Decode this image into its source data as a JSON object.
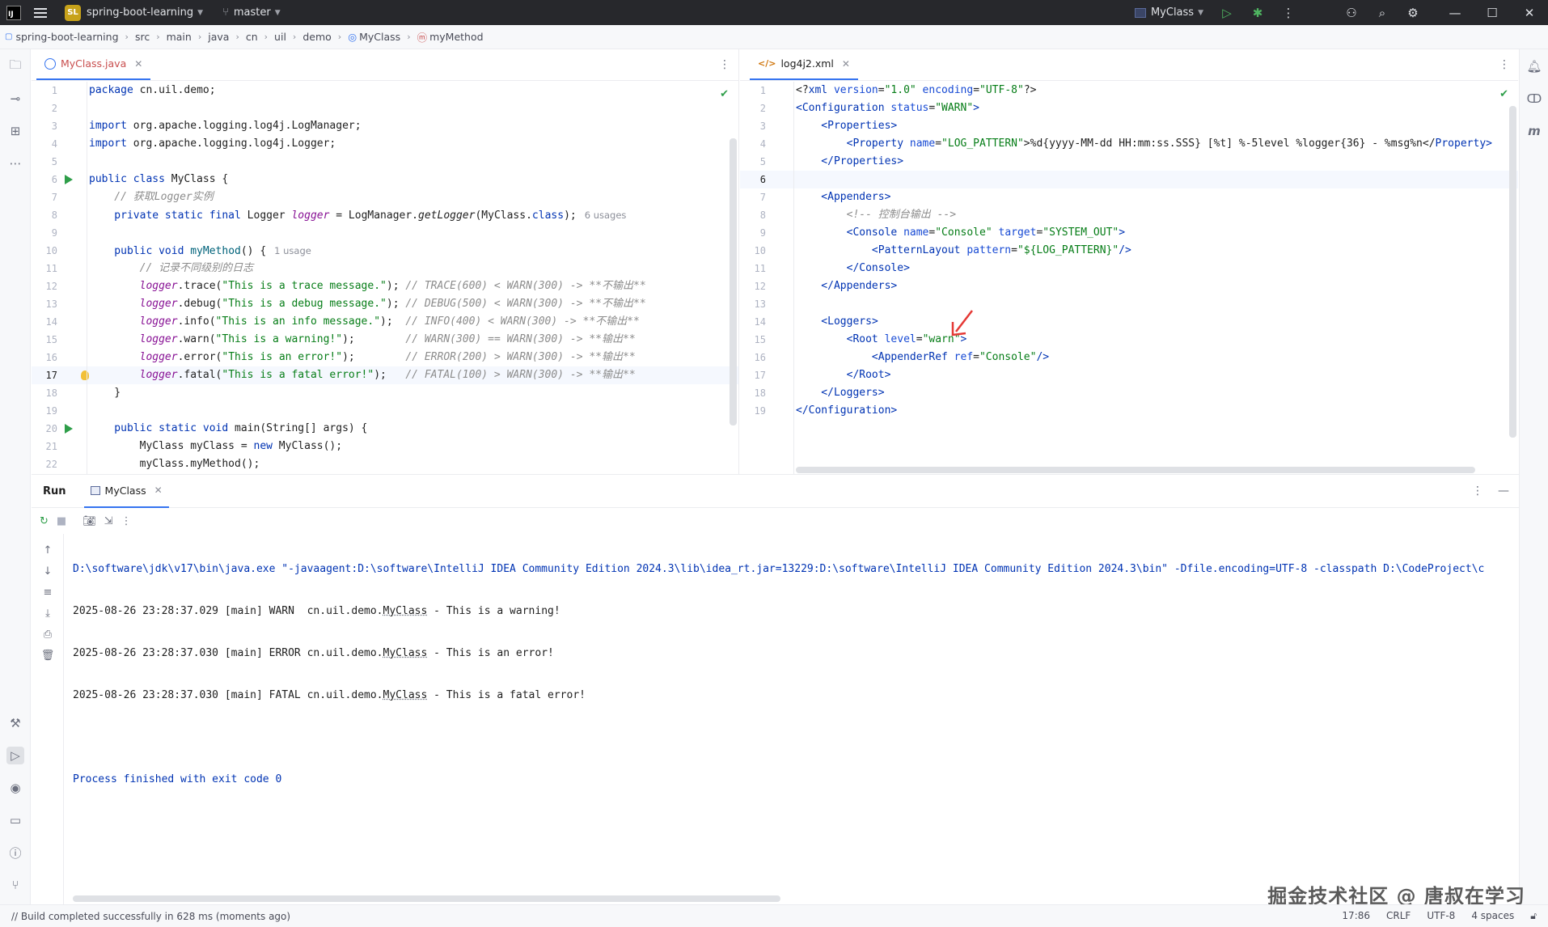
{
  "titlebar": {
    "app_logo": "IJ",
    "project_badge": "SL",
    "project_name": "spring-boot-learning",
    "branch": "master",
    "run_config": "MyClass"
  },
  "breadcrumb": [
    "spring-boot-learning",
    "src",
    "main",
    "java",
    "cn",
    "uil",
    "demo",
    "MyClass",
    "myMethod"
  ],
  "left_editor": {
    "tab": "MyClass.java",
    "lines": [
      {
        "n": "1"
      },
      {
        "n": "2"
      },
      {
        "n": "3"
      },
      {
        "n": "4"
      },
      {
        "n": "5"
      },
      {
        "n": "6"
      },
      {
        "n": "7"
      },
      {
        "n": "8"
      },
      {
        "n": "9"
      },
      {
        "n": "10"
      },
      {
        "n": "11"
      },
      {
        "n": "12"
      },
      {
        "n": "13"
      },
      {
        "n": "14"
      },
      {
        "n": "15"
      },
      {
        "n": "16"
      },
      {
        "n": "17"
      },
      {
        "n": "18"
      },
      {
        "n": "19"
      },
      {
        "n": "20"
      },
      {
        "n": "21"
      },
      {
        "n": "22"
      }
    ],
    "code": {
      "l1_pkg": "package",
      "l1_name": " cn.uil.demo;",
      "l3_imp": "import",
      "l3_name": " org.apache.logging.log4j.LogManager;",
      "l4_imp": "import",
      "l4_name": " org.apache.logging.log4j.Logger;",
      "l6_kw": "public class",
      "l6_name": " MyClass {",
      "l7_cm": "    // 获取Logger实例",
      "l8_kw": "    private static final",
      "l8_type": " Logger ",
      "l8_fld": "logger",
      "l8_eq": " = LogManager.",
      "l8_mth": "getLogger",
      "l8_arg": "(MyClass.",
      "l8_cls": "class",
      "l8_end": ");",
      "l8_hint": "6 usages",
      "l10_kw": "    public void",
      "l10_name": " myMethod",
      "l10_end": "() {",
      "l10_hint": "1 usage",
      "l11_cm": "        // 记录不同级别的日志",
      "l12_fld": "        logger",
      "l12_call": ".trace(",
      "l12_str": "\"This is a trace message.\"",
      "l12_end": "); ",
      "l12_cm": "// TRACE(600) < WARN(300) -> **不输出**",
      "l13_fld": "        logger",
      "l13_call": ".debug(",
      "l13_str": "\"This is a debug message.\"",
      "l13_end": "); ",
      "l13_cm": "// DEBUG(500) < WARN(300) -> **不输出**",
      "l14_fld": "        logger",
      "l14_call": ".info(",
      "l14_str": "\"This is an info message.\"",
      "l14_end": ");  ",
      "l14_cm": "// INFO(400) < WARN(300) -> **不输出**",
      "l15_fld": "        logger",
      "l15_call": ".warn(",
      "l15_str": "\"This is a warning!\"",
      "l15_end": ");        ",
      "l15_cm": "// WARN(300) == WARN(300) -> **输出**",
      "l16_fld": "        logger",
      "l16_call": ".error(",
      "l16_str": "\"This is an error!\"",
      "l16_end": ");        ",
      "l16_cm": "// ERROR(200) > WARN(300) -> **输出**",
      "l17_fld": "        logger",
      "l17_call": ".fatal(",
      "l17_str": "\"This is a fatal error!\"",
      "l17_end": ");   ",
      "l17_cm": "// FATAL(100) > WARN(300) -> **输出**",
      "l18": "    }",
      "l20_kw": "    public static void",
      "l20_name": " main(String[] args) {",
      "l21_a": "        MyClass myClass = ",
      "l21_kw": "new",
      "l21_b": " MyClass();",
      "l22": "        myClass.myMethod();"
    }
  },
  "right_editor": {
    "tab": "log4j2.xml",
    "lines": [
      {
        "n": "1"
      },
      {
        "n": "2"
      },
      {
        "n": "3"
      },
      {
        "n": "4"
      },
      {
        "n": "5"
      },
      {
        "n": "6"
      },
      {
        "n": "7"
      },
      {
        "n": "8"
      },
      {
        "n": "9"
      },
      {
        "n": "10"
      },
      {
        "n": "11"
      },
      {
        "n": "12"
      },
      {
        "n": "13"
      },
      {
        "n": "14"
      },
      {
        "n": "15"
      },
      {
        "n": "16"
      },
      {
        "n": "17"
      },
      {
        "n": "18"
      },
      {
        "n": "19"
      }
    ],
    "code": {
      "x1_a": "<?",
      "x1_tag": "xml",
      "x1_attr1": " version",
      "x1_eq1": "=",
      "x1_val1": "\"1.0\"",
      "x1_attr2": " encoding",
      "x1_eq2": "=",
      "x1_val2": "\"UTF-8\"",
      "x1_b": "?>",
      "x2_a": "<",
      "x2_tag": "Configuration",
      "x2_attr": " status",
      "x2_eq": "=",
      "x2_val": "\"WARN\"",
      "x2_b": ">",
      "x3_a": "    <",
      "x3_tag": "Properties",
      "x3_b": ">",
      "x4_a": "        <",
      "x4_tag": "Property",
      "x4_attr": " name",
      "x4_eq": "=",
      "x4_val": "\"LOG_PATTERN\"",
      "x4_b": ">%d{yyyy-MM-dd HH:mm:ss.SSS} [%t] %-5level %logger{36} - %msg%n</",
      "x4_tag2": "Property",
      "x4_c": ">",
      "x5_a": "    </",
      "x5_tag": "Properties",
      "x5_b": ">",
      "x7_a": "    <",
      "x7_tag": "Appenders",
      "x7_b": ">",
      "x8_cm": "        <!-- 控制台输出 -->",
      "x9_a": "        <",
      "x9_tag": "Console",
      "x9_attr1": " name",
      "x9_eq1": "=",
      "x9_val1": "\"Console\"",
      "x9_attr2": " target",
      "x9_eq2": "=",
      "x9_val2": "\"SYSTEM_OUT\"",
      "x9_b": ">",
      "x10_a": "            <",
      "x10_tag": "PatternLayout",
      "x10_attr": " pattern",
      "x10_eq": "=",
      "x10_val": "\"${LOG_PATTERN}\"",
      "x10_b": "/>",
      "x11_a": "        </",
      "x11_tag": "Console",
      "x11_b": ">",
      "x12_a": "    </",
      "x12_tag": "Appenders",
      "x12_b": ">",
      "x14_a": "    <",
      "x14_tag": "Loggers",
      "x14_b": ">",
      "x15_a": "        <",
      "x15_tag": "Root",
      "x15_attr": " level",
      "x15_eq": "=",
      "x15_val": "\"warn\"",
      "x15_b": ">",
      "x16_a": "            <",
      "x16_tag": "AppenderRef",
      "x16_attr": " ref",
      "x16_eq": "=",
      "x16_val": "\"Console\"",
      "x16_b": "/>",
      "x17_a": "        </",
      "x17_tag": "Root",
      "x17_b": ">",
      "x18_a": "    </",
      "x18_tag": "Loggers",
      "x18_b": ">",
      "x19_a": "</",
      "x19_tag": "Configuration",
      "x19_b": ">"
    }
  },
  "run_panel": {
    "title": "Run",
    "tab": "MyClass",
    "cmd": "D:\\software\\jdk\\v17\\bin\\java.exe \"-javaagent:D:\\software\\IntelliJ IDEA Community Edition 2024.3\\lib\\idea_rt.jar=13229:D:\\software\\IntelliJ IDEA Community Edition 2024.3\\bin\" -Dfile.encoding=UTF-8 -classpath D:\\CodeProject\\c",
    "out1_a": "2025-08-26 23:28:37.029 [main] WARN  cn.uil.demo.",
    "out1_cls": "MyClass",
    "out1_b": " - This is a warning!",
    "out2_a": "2025-08-26 23:28:37.030 [main] ERROR cn.uil.demo.",
    "out2_cls": "MyClass",
    "out2_b": " - This is an error!",
    "out3_a": "2025-08-26 23:28:37.030 [main] FATAL cn.uil.demo.",
    "out3_cls": "MyClass",
    "out3_b": " - This is a fatal error!",
    "exit": "Process finished with exit code 0"
  },
  "statusbar": {
    "message": "// Build completed successfully in 628 ms (moments ago)",
    "position": "17:86",
    "line_sep": "CRLF",
    "encoding": "UTF-8",
    "indent": "4 spaces"
  },
  "watermark": "掘金技术社区 @ 唐叔在学习",
  "colors": {
    "accent": "#3574f0",
    "run_green": "#2e9e49",
    "annotation_red": "#e53935",
    "titlebar_bg": "#27282c"
  }
}
